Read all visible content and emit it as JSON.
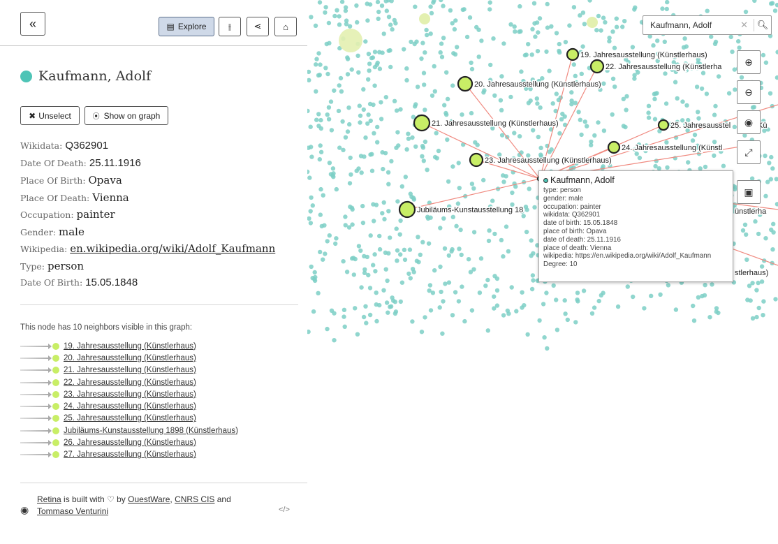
{
  "topbar": {
    "collapse_icon": "«",
    "explore_label": "Explore",
    "explore_icon": "▤",
    "tune_icon": "⫲",
    "share_icon": "⋖",
    "home_icon": "⌂"
  },
  "node": {
    "name": "Kaufmann, Adolf",
    "color": "#4ec4b6",
    "unselect_label": "Unselect",
    "show_on_graph_label": "Show on graph",
    "attributes": [
      {
        "key": "Wikidata: ",
        "value": "Q362901"
      },
      {
        "key": "Date Of Death: ",
        "value": "25.11.1916"
      },
      {
        "key": "Place Of Birth: ",
        "value": "Opava"
      },
      {
        "key": "Place Of Death: ",
        "value": "Vienna"
      },
      {
        "key": "Occupation: ",
        "value": "painter"
      },
      {
        "key": "Gender: ",
        "value": "male"
      },
      {
        "key": "Wikipedia: ",
        "value": "en.wikipedia.org/wiki/Adolf_Kaufmann"
      },
      {
        "key": "Type: ",
        "value": "person"
      },
      {
        "key": "Date Of Birth: ",
        "value": "15.05.1848"
      }
    ]
  },
  "neighbors": {
    "header": "This node has 10 neighbors visible in this graph:",
    "items": [
      "19. Jahresausstellung (Künstlerhaus)",
      "20. Jahresausstellung (Künstlerhaus)",
      "21. Jahresausstellung (Künstlerhaus)",
      "22. Jahresausstellung (Künstlerhaus)",
      "23. Jahresausstellung (Künstlerhaus)",
      "24. Jahresausstellung (Künstlerhaus)",
      "25. Jahresausstellung (Künstlerhaus)",
      "Jubiläums-Kunstausstellung 1898 (Künstlerhaus)",
      "26. Jahresausstellung (Künstlerhaus)",
      "27. Jahresausstellung (Künstlerhaus)"
    ],
    "dot_color": "#c8ee66"
  },
  "footer": {
    "retina": "Retina",
    "built_with": " is built with ♡ by ",
    "questware": "OuestWare",
    "sep": ", ",
    "cnrs": "CNRS CIS",
    "and": " and",
    "tommaso": "Tommaso Venturini",
    "code_icon": "</>"
  },
  "graph": {
    "search_value": "Kaufmann, Adolf",
    "search_clear_icon": "✕",
    "search_icon": "🔍︎",
    "zoom_in_icon": "⊕",
    "zoom_out_icon": "⊖",
    "center_icon": "◉",
    "fullscreen_icon": "⤢",
    "export_icon": "▣",
    "labels": [
      "19. Jahresausstellung (Künstlerhaus)",
      "22. Jahresausstellung (Künstlerha",
      "20. Jahresausstellung (Künstlerhaus)",
      "21. Jahresausstellung (Künstlerhaus)",
      "25. Jahresausstel",
      "Kü",
      "24. Jahresausstellung (Künstl",
      "23. Jahresausstellung (Künstlerhaus)",
      "Jubiläums-Kunstausstellung 18",
      "ünstlerha",
      "stlerhaus)"
    ],
    "node_color": "#7ccfc6",
    "edge_color": "#f08a80"
  },
  "tooltip": {
    "title": "Kaufmann, Adolf",
    "rows": [
      "type: person",
      "gender: male",
      "occupation: painter",
      "wikidata: Q362901",
      "date of birth: 15.05.1848",
      "place of birth: Opava",
      "date of death: 25.11.1916",
      "place of death: Vienna",
      "wikipedia: https://en.wikipedia.org/wiki/Adolf_Kaufmann",
      "Degree: 10"
    ]
  }
}
